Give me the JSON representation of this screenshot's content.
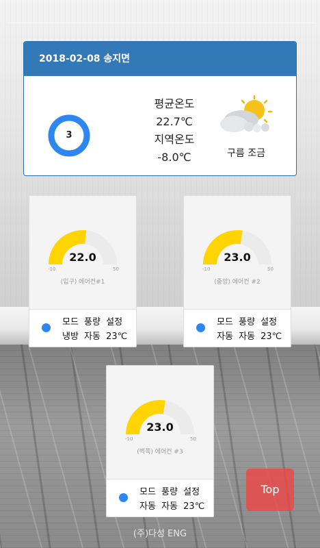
{
  "summary": {
    "header": "2018-02-08 송지면",
    "ring_value": "3",
    "avg_temp_label": "평균온도",
    "avg_temp_value": "22.7℃",
    "local_temp_label": "지역온도",
    "local_temp_value": "-8.0℃",
    "weather_icon": "partly-cloudy-icon",
    "weather_text": "구름 조금"
  },
  "gauge_range": {
    "min_label": "-10",
    "max_label": "50",
    "min": -10,
    "max": 50
  },
  "units": [
    {
      "value": "22.0",
      "value_num": 22.0,
      "name": "(입구) 에어컨#1",
      "header_row": "모드 풍량 설정",
      "status_row": "냉방 자동 23℃"
    },
    {
      "value": "23.0",
      "value_num": 23.0,
      "name": "(중앙) 에어컨 #2",
      "header_row": "모드 풍량 설정",
      "status_row": "자동 자동 23℃"
    },
    {
      "value": "23.0",
      "value_num": 23.0,
      "name": "(벽쪽) 에어컨 #3",
      "header_row": "모드 풍량 설정",
      "status_row": "자동 자동 23℃"
    }
  ],
  "top_button": "Top",
  "footer": "(주)다성 ENG",
  "colors": {
    "header": "#3479b7",
    "ring": "#2e86f0",
    "gauge_fill": "#ffd400",
    "gauge_track": "#ebebeb",
    "status_dot": "#2e86f0",
    "top_button": "#ec4848"
  }
}
